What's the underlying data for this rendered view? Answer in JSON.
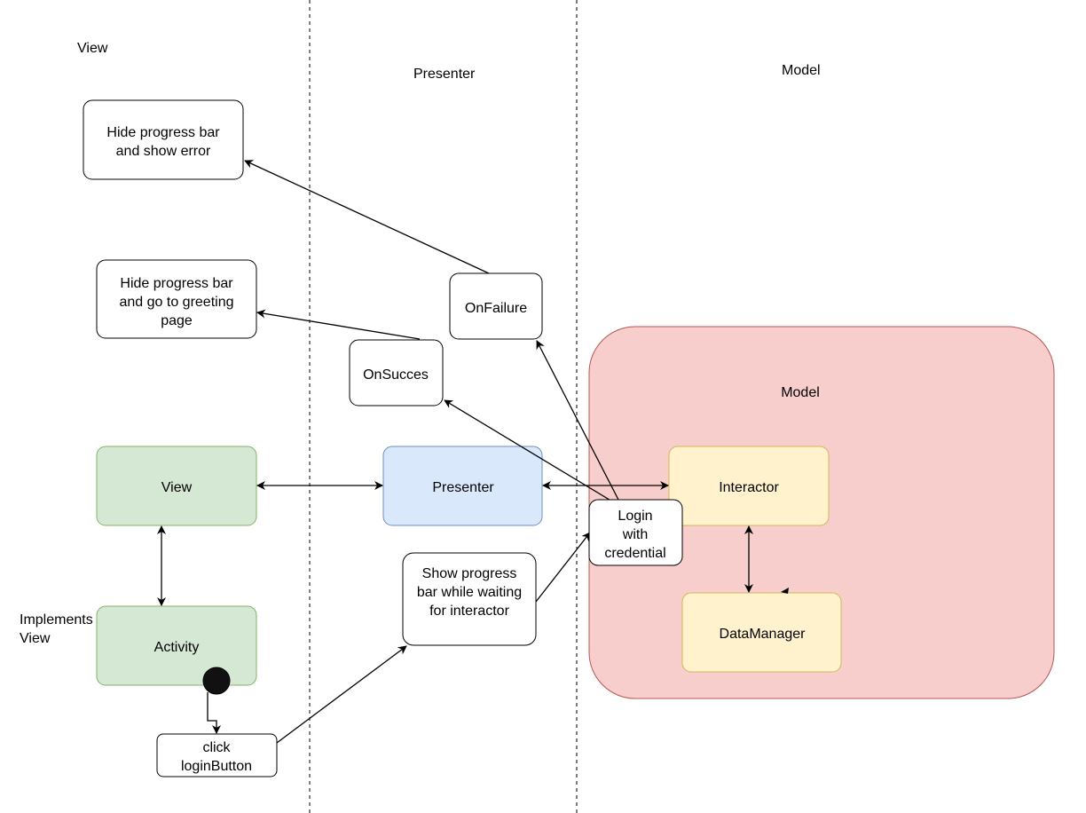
{
  "lanes": {
    "view": "View",
    "presenter": "Presenter",
    "model": "Model"
  },
  "implements_label": [
    "Implements",
    "View"
  ],
  "nodes": {
    "show_error": [
      "Hide progress bar",
      "and show error"
    ],
    "greeting": [
      "Hide progress bar",
      "and go to greeting",
      "page"
    ],
    "on_failure": "OnFailure",
    "on_success": "OnSucces",
    "model_container": "Model",
    "view": "View",
    "presenter": "Presenter",
    "interactor": "Interactor",
    "login": [
      "Login",
      "with",
      "credential"
    ],
    "show_progress": [
      "Show progress",
      "bar while waiting",
      "for interactor"
    ],
    "activity": "Activity",
    "data_manager": "DataManager",
    "click": [
      "click",
      "loginButton"
    ]
  },
  "colors": {
    "view_fill": "#d5e8d4",
    "view_stroke": "#82b366",
    "presenter_fill": "#dae8fc",
    "presenter_stroke": "#6c8ebf",
    "model_fill": "#f8cecc",
    "model_stroke": "#b85450",
    "interactor_fill": "#fff2cc",
    "interactor_stroke": "#d6b656"
  }
}
